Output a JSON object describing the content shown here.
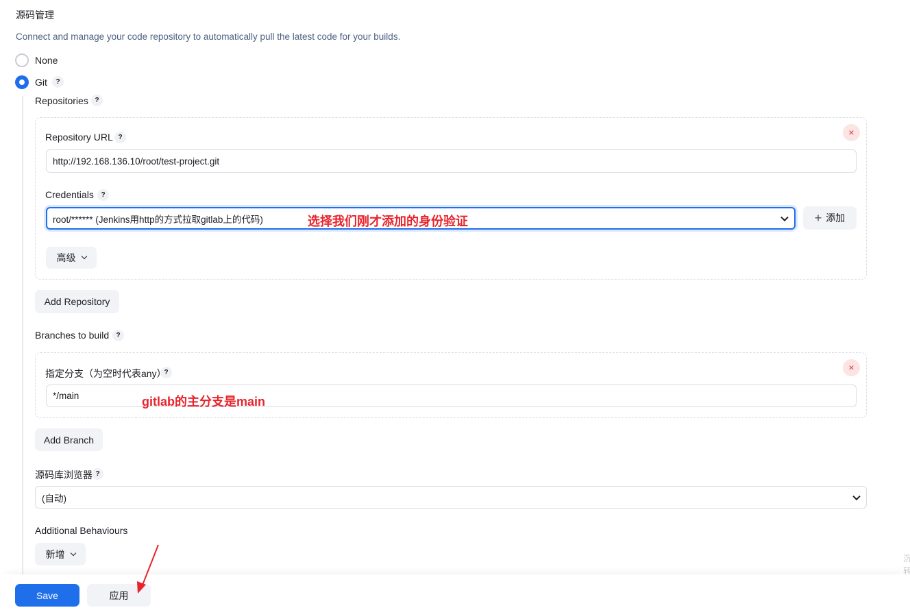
{
  "section": {
    "title": "源码管理",
    "description": "Connect and manage your code repository to automatically pull the latest code for your builds."
  },
  "scm_options": {
    "none_label": "None",
    "git_label": "Git",
    "help": "?"
  },
  "repositories": {
    "label": "Repositories",
    "repo_url_label": "Repository URL",
    "repo_url_value": "http://192.168.136.10/root/test-project.git",
    "credentials_label": "Credentials",
    "credentials_value": "root/****** (Jenkins用http的方式拉取gitlab上的代码)",
    "add_label": "添加",
    "advanced_label": "高级",
    "add_repository_label": "Add Repository",
    "close": "×"
  },
  "branches": {
    "label": "Branches to build",
    "specifier_label": "指定分支（为空时代表any）",
    "specifier_value": "*/main",
    "add_branch_label": "Add Branch",
    "close": "×"
  },
  "browser": {
    "label": "源码库浏览器",
    "value": "(自动)"
  },
  "behaviours": {
    "label": "Additional Behaviours",
    "add_label": "新增"
  },
  "footer": {
    "save_label": "Save",
    "apply_label": "应用"
  },
  "annotations": {
    "credentials_note": "选择我们刚才添加的身份验证",
    "branch_note": "gitlab的主分支是main"
  },
  "side_text": "沉 转",
  "icons": {
    "help": "question-mark-icon",
    "close": "close-icon",
    "chevron": "chevron-down-icon",
    "plus": "plus-icon",
    "arrow": "red-arrow-annotation"
  },
  "colors": {
    "primary": "#1f6feb",
    "annotation": "#e8232b",
    "danger": "#e03131",
    "description": "#4c5f80"
  }
}
